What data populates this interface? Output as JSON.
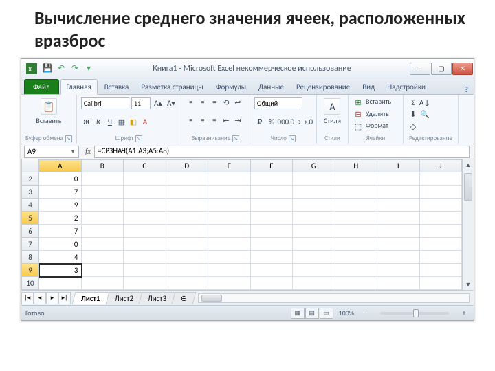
{
  "slide": {
    "title": "Вычисление среднего значения ячеек, расположенных вразброс"
  },
  "titlebar": {
    "title": "Книга1 - Microsoft Excel некоммерческое использование"
  },
  "tabs": {
    "file": "Файл",
    "items": [
      "Главная",
      "Вставка",
      "Разметка страницы",
      "Формулы",
      "Данные",
      "Рецензирование",
      "Вид",
      "Надстройки"
    ],
    "active_index": 0,
    "help": "?"
  },
  "ribbon": {
    "clipboard": {
      "label": "Буфер обмена",
      "paste": "Вставить"
    },
    "font": {
      "label": "Шрифт",
      "name": "Calibri",
      "size": "11",
      "bold": "Ж",
      "italic": "К",
      "underline": "Ч"
    },
    "align": {
      "label": "Выравнивание"
    },
    "number": {
      "label": "Число",
      "format": "Общий"
    },
    "styles": {
      "label": "Стили",
      "btn": "Стили"
    },
    "cells": {
      "label": "Ячейки",
      "insert": "Вставить",
      "delete": "Удалить",
      "format": "Формат"
    },
    "editing": {
      "label": "Редактирование"
    }
  },
  "formula_bar": {
    "cell_ref": "A9",
    "fx": "fx",
    "formula": "=СРЗНАЧ(A1:A3;A5:A8)"
  },
  "grid": {
    "columns": [
      "A",
      "B",
      "C",
      "D",
      "E",
      "F",
      "G",
      "H",
      "I",
      "J"
    ],
    "rows": [
      {
        "n": 2,
        "A": "0"
      },
      {
        "n": 3,
        "A": "7"
      },
      {
        "n": 4,
        "A": "9"
      },
      {
        "n": 5,
        "A": "2"
      },
      {
        "n": 6,
        "A": "7"
      },
      {
        "n": 7,
        "A": "0"
      },
      {
        "n": 8,
        "A": "4"
      },
      {
        "n": 9,
        "A": "3"
      },
      {
        "n": 10,
        "A": ""
      }
    ],
    "active_col": "A",
    "active_row": 9,
    "hl_rows": [
      5,
      9
    ]
  },
  "sheets": {
    "tabs": [
      "Лист1",
      "Лист2",
      "Лист3"
    ],
    "active_index": 0
  },
  "status": {
    "ready": "Готово",
    "zoom": "100%"
  }
}
